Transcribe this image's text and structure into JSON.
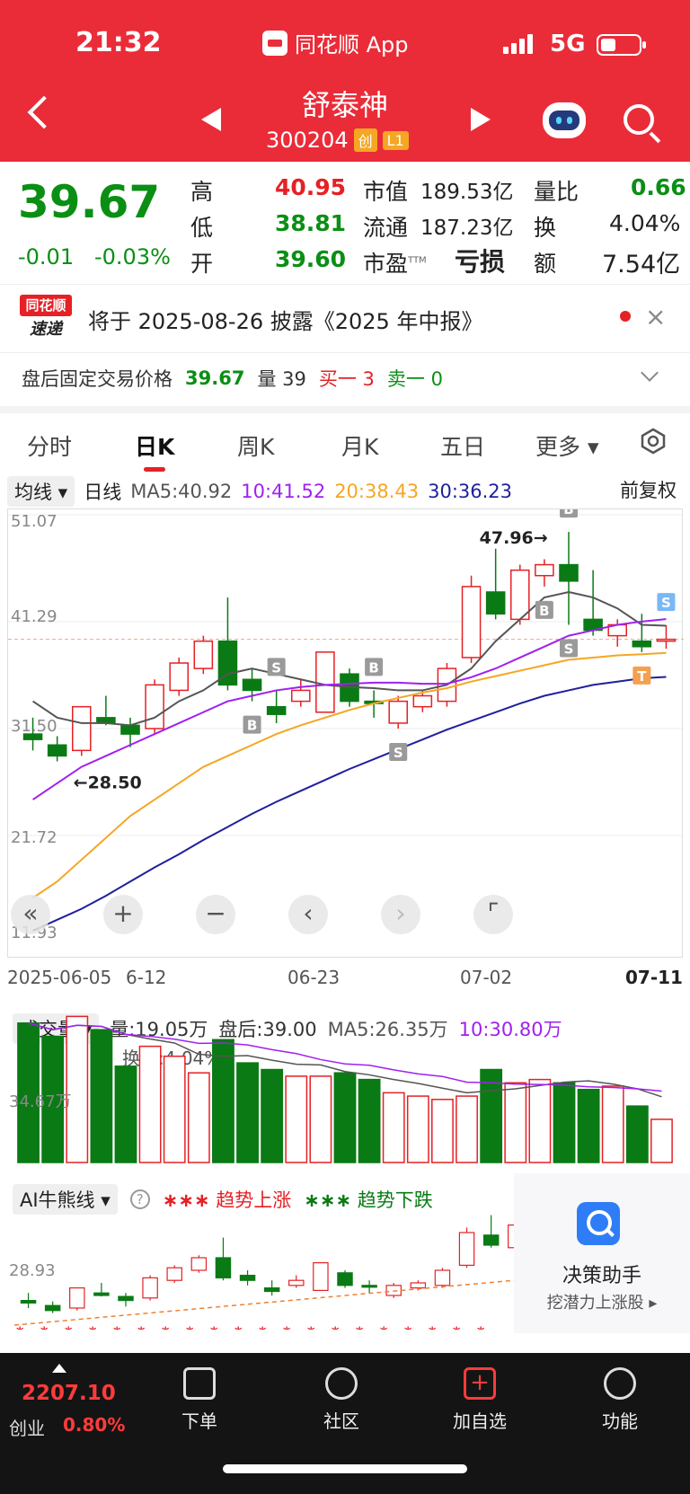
{
  "status": {
    "time": "21:32",
    "app_label": "同花顺 App",
    "network": "5G"
  },
  "header": {
    "name": "舒泰神",
    "code": "300204",
    "board_tag": "创",
    "level_tag": "L1"
  },
  "quote": {
    "price": "39.67",
    "change": "-0.01",
    "change_pct": "-0.03%",
    "high_label": "高",
    "high": "40.95",
    "low_label": "低",
    "low": "38.81",
    "open_label": "开",
    "open": "39.60",
    "mcap_label": "市值",
    "mcap": "189.53亿",
    "float_label": "流通",
    "float": "187.23亿",
    "pe_label": "市盈",
    "pe_sup": "TTM",
    "pe": "亏损",
    "vr_label": "量比",
    "vr": "0.66",
    "turnover_label": "换",
    "turnover": "4.04%",
    "amount_label": "额",
    "amount": "7.54亿"
  },
  "news": {
    "logo_top": "同花顺",
    "logo_bottom": "速递",
    "text": "将于 2025-08-26 披露《2025 年中报》"
  },
  "after_hours": {
    "label": "盘后固定交易价格",
    "price": "39.67",
    "vol_label": "量",
    "vol": "39",
    "buy": "买一 3",
    "sell": "卖一 0"
  },
  "tabs": [
    "分时",
    "日K",
    "周K",
    "月K",
    "五日",
    "更多"
  ],
  "active_tab": "日K",
  "ma_bar": {
    "selector": "均线",
    "period": "日线",
    "ma5": "MA5:40.92",
    "ma10": "10:41.52",
    "ma20": "20:38.43",
    "ma30": "30:36.23",
    "adjust": "前复权"
  },
  "colors": {
    "up": "#e52125",
    "down": "#0a7a14",
    "ma5": "#555555",
    "ma10": "#a020f0",
    "ma20": "#f5a623",
    "ma30": "#1f1f9e"
  },
  "chart_data": {
    "type": "candlestick",
    "y_ticks": [
      "51.07",
      "41.29",
      "31.50",
      "21.72",
      "11.93"
    ],
    "x_labels": [
      "2025-06-05",
      "6-12",
      "06-23",
      "07-02",
      "07-11"
    ],
    "annotations": {
      "high": "47.96→",
      "low": "←28.50"
    },
    "markers": [
      "S",
      "B",
      "B",
      "S",
      "B",
      "S",
      "B",
      "S",
      "S",
      "T"
    ],
    "candles": [
      {
        "o": 31.0,
        "c": 30.5,
        "h": 32.5,
        "l": 29.5
      },
      {
        "o": 30.0,
        "c": 29.0,
        "h": 30.8,
        "l": 28.5
      },
      {
        "o": 29.5,
        "c": 33.5,
        "h": 33.5,
        "l": 29.0
      },
      {
        "o": 32.5,
        "c": 32.0,
        "h": 34.5,
        "l": 31.8
      },
      {
        "o": 31.8,
        "c": 31.0,
        "h": 32.5,
        "l": 29.8
      },
      {
        "o": 31.5,
        "c": 35.5,
        "h": 36.0,
        "l": 31.0
      },
      {
        "o": 35.0,
        "c": 37.5,
        "h": 38.0,
        "l": 34.5
      },
      {
        "o": 37.0,
        "c": 39.5,
        "h": 40.0,
        "l": 36.5
      },
      {
        "o": 39.5,
        "c": 35.5,
        "h": 43.5,
        "l": 35.0
      },
      {
        "o": 36.0,
        "c": 35.0,
        "h": 37.0,
        "l": 34.0
      },
      {
        "o": 33.5,
        "c": 32.8,
        "h": 35.0,
        "l": 32.0
      },
      {
        "o": 34.0,
        "c": 35.0,
        "h": 36.0,
        "l": 33.5
      },
      {
        "o": 33.0,
        "c": 38.5,
        "h": 38.5,
        "l": 33.0
      },
      {
        "o": 36.5,
        "c": 34.0,
        "h": 37.0,
        "l": 33.5
      },
      {
        "o": 34.0,
        "c": 33.8,
        "h": 35.0,
        "l": 32.5
      },
      {
        "o": 32.0,
        "c": 34.0,
        "h": 34.5,
        "l": 31.5
      },
      {
        "o": 33.5,
        "c": 34.5,
        "h": 35.0,
        "l": 33.0
      },
      {
        "o": 34.0,
        "c": 37.0,
        "h": 37.5,
        "l": 33.5
      },
      {
        "o": 38.0,
        "c": 44.5,
        "h": 45.5,
        "l": 37.5
      },
      {
        "o": 44.0,
        "c": 42.0,
        "h": 47.96,
        "l": 41.5
      },
      {
        "o": 41.5,
        "c": 46.0,
        "h": 46.5,
        "l": 41.0
      },
      {
        "o": 45.5,
        "c": 46.5,
        "h": 47.0,
        "l": 44.5
      },
      {
        "o": 46.5,
        "c": 45.0,
        "h": 49.5,
        "l": 41.0
      },
      {
        "o": 41.5,
        "c": 40.5,
        "h": 46.0,
        "l": 40.0
      },
      {
        "o": 40.0,
        "c": 41.0,
        "h": 41.5,
        "l": 39.0
      },
      {
        "o": 39.5,
        "c": 39.0,
        "h": 42.0,
        "l": 38.5
      },
      {
        "o": 39.6,
        "c": 39.67,
        "h": 40.95,
        "l": 38.81
      }
    ],
    "ma5": [
      34.0,
      32.5,
      32.0,
      32.0,
      31.8,
      32.5,
      34.0,
      35.0,
      36.5,
      37.0,
      36.5,
      36.0,
      35.5,
      35.3,
      35.2,
      35.0,
      35.0,
      35.5,
      37.0,
      39.5,
      41.5,
      43.5,
      44.0,
      43.5,
      42.5,
      41.0,
      40.92
    ],
    "ma10": [
      25.0,
      26.5,
      28.0,
      29.0,
      30.0,
      31.0,
      32.0,
      33.0,
      34.0,
      34.5,
      35.0,
      35.3,
      35.5,
      35.6,
      35.7,
      35.7,
      35.6,
      35.6,
      36.2,
      37.0,
      38.0,
      39.0,
      40.0,
      40.5,
      41.0,
      41.3,
      41.52
    ],
    "ma20": [
      16.0,
      17.5,
      19.5,
      21.5,
      23.5,
      25.0,
      26.5,
      28.0,
      29.0,
      30.0,
      31.0,
      31.8,
      32.5,
      33.2,
      33.8,
      34.3,
      34.8,
      35.2,
      35.8,
      36.3,
      36.8,
      37.3,
      37.8,
      38.0,
      38.2,
      38.3,
      38.43
    ],
    "ma30": [
      13.0,
      14.0,
      15.0,
      16.2,
      17.5,
      18.8,
      20.0,
      21.3,
      22.5,
      23.7,
      24.8,
      25.8,
      26.8,
      27.8,
      28.7,
      29.6,
      30.5,
      31.4,
      32.2,
      33.0,
      33.8,
      34.5,
      35.0,
      35.5,
      35.8,
      36.1,
      36.23
    ],
    "y_range": [
      11.93,
      51.07
    ]
  },
  "volume": {
    "selector": "成交量",
    "vol": "量:19.05万",
    "after": "盘后:39.00",
    "ma5": "MA5:26.35万",
    "ma10": "10:30.80万",
    "turn": "换手:4.04%",
    "axis": "34.67万",
    "values": [
      42,
      38,
      44,
      40,
      29,
      35,
      32,
      27,
      37,
      30,
      28,
      26,
      26,
      27,
      25,
      21,
      20,
      19,
      20,
      28,
      24,
      25,
      24,
      22,
      23,
      17,
      13
    ]
  },
  "ai": {
    "selector": "AI牛熊线",
    "legend_up": "趋势上涨",
    "legend_down": "趋势下跌",
    "axis": "28.93",
    "assistant_title": "决策助手",
    "assistant_sub": "挖潜力上涨股"
  },
  "index": {
    "value": "2207.10",
    "name": "创业",
    "pct": "0.80%"
  },
  "bottom_nav": [
    "下单",
    "社区",
    "加自选",
    "功能"
  ]
}
